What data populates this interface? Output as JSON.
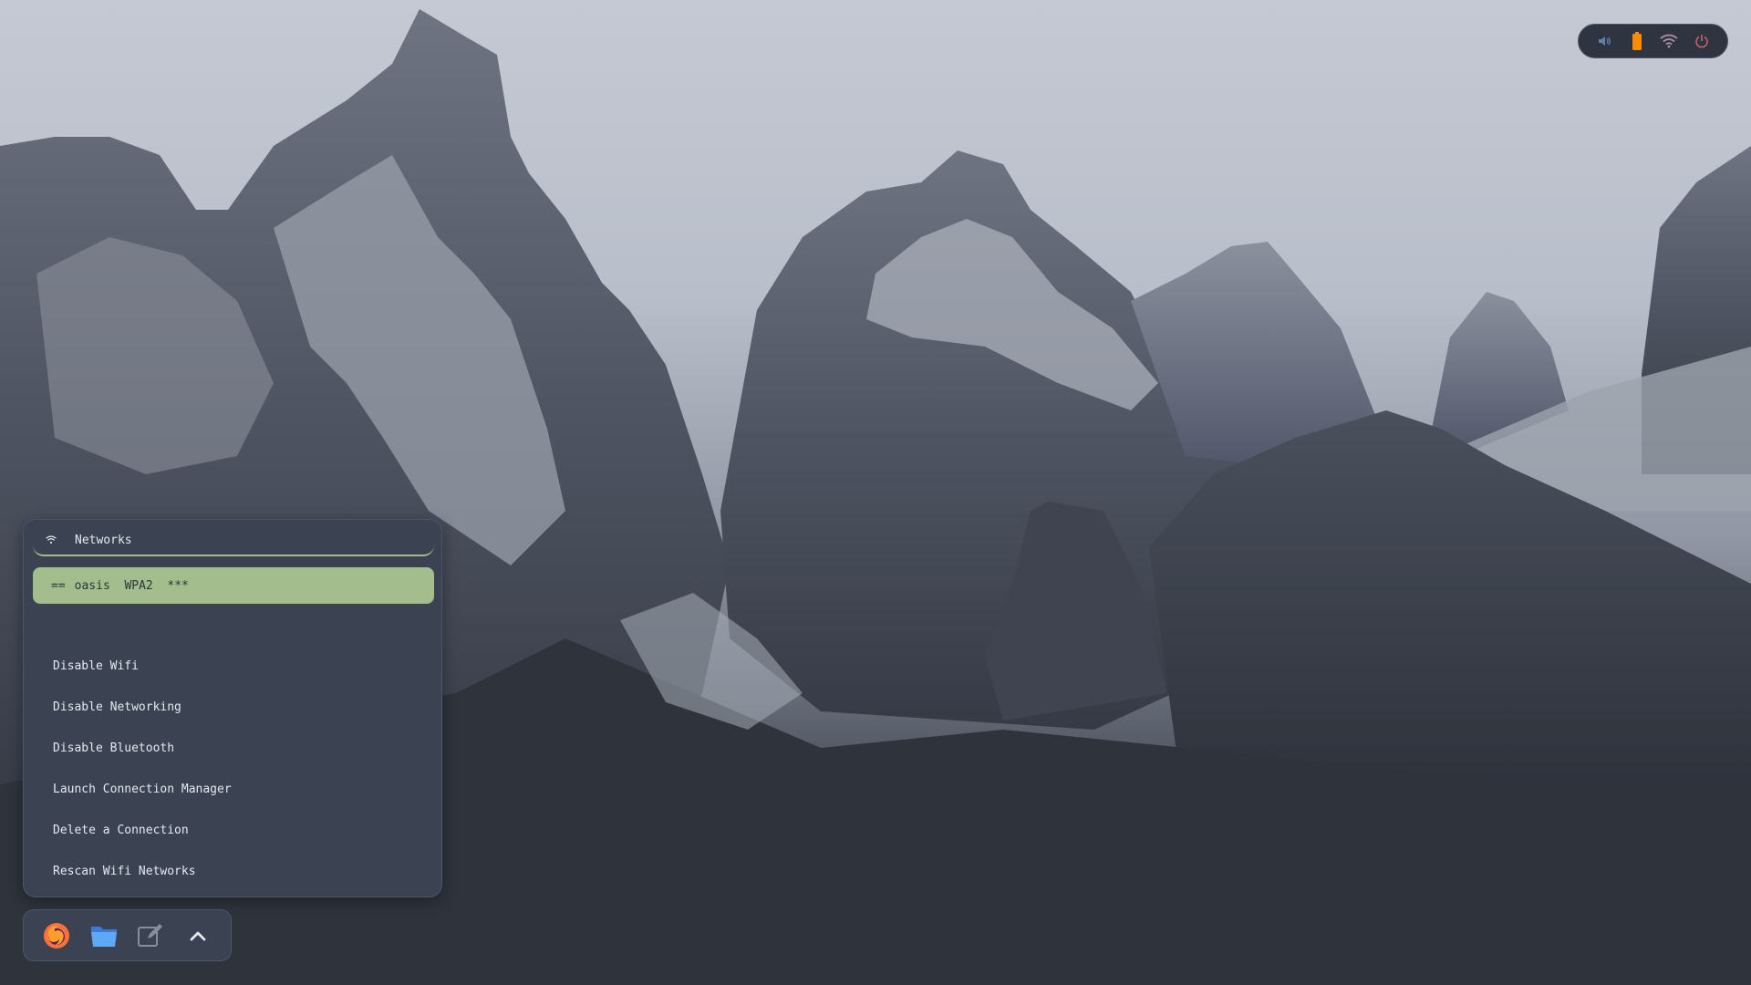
{
  "tray": {
    "icons": [
      "volume-icon",
      "battery-icon",
      "wifi-icon",
      "power-icon"
    ],
    "colors": {
      "volume": "#5e81ac",
      "battery": "#ff8c00",
      "wifi": "#b48ead",
      "power": "#bf616a"
    }
  },
  "network_menu": {
    "search": {
      "prompt": "Networks",
      "icon": "wifi-icon"
    },
    "selected_network": {
      "marker": "==",
      "text": "oasis  WPA2  ***"
    },
    "actions": [
      "Disable Wifi",
      "Disable Networking",
      "Disable Bluetooth",
      "Launch Connection Manager",
      "Delete a Connection",
      "Rescan Wifi Networks"
    ],
    "colors": {
      "panel": "#3b4252",
      "accent": "#a3be8c",
      "text": "#e5e9f0"
    }
  },
  "dock": {
    "apps": [
      "firefox-icon",
      "folder-icon",
      "text-editor-icon",
      "chevron-up-icon"
    ]
  }
}
